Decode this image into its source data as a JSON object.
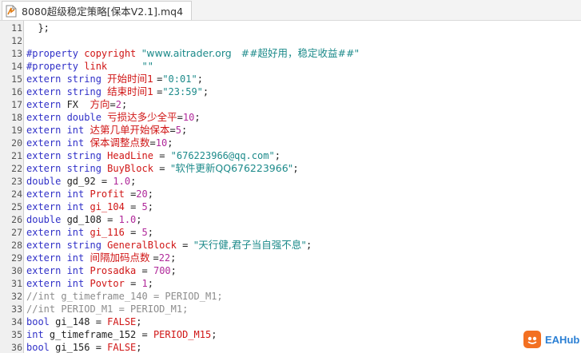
{
  "tab": {
    "title": "8080超级稳定策略[保本V2.1].mq4",
    "icon": "mq4-file-icon"
  },
  "watermark": {
    "text": "EAHub"
  },
  "lines": [
    {
      "n": "11",
      "tokens": [
        {
          "t": "  };",
          "c": "plain"
        }
      ]
    },
    {
      "n": "12",
      "tokens": []
    },
    {
      "n": "13",
      "tokens": [
        {
          "t": "#property ",
          "c": "kw"
        },
        {
          "t": "copyright ",
          "c": "red"
        },
        {
          "t": "\"www.aitrader.org   ##超好用，稳定收益##\"",
          "c": "str"
        }
      ]
    },
    {
      "n": "14",
      "tokens": [
        {
          "t": "#property ",
          "c": "kw"
        },
        {
          "t": "link      ",
          "c": "red"
        },
        {
          "t": "\"\"",
          "c": "str"
        }
      ]
    },
    {
      "n": "15",
      "tokens": [
        {
          "t": "extern ",
          "c": "kw"
        },
        {
          "t": "string ",
          "c": "kw"
        },
        {
          "t": "开始时间1 ",
          "c": "red"
        },
        {
          "t": "=",
          "c": "plain"
        },
        {
          "t": "\"0:01\"",
          "c": "str"
        },
        {
          "t": ";",
          "c": "plain"
        }
      ]
    },
    {
      "n": "16",
      "tokens": [
        {
          "t": "extern ",
          "c": "kw"
        },
        {
          "t": "string ",
          "c": "kw"
        },
        {
          "t": "结束时间1 ",
          "c": "red"
        },
        {
          "t": "=",
          "c": "plain"
        },
        {
          "t": "\"23:59\"",
          "c": "str"
        },
        {
          "t": ";",
          "c": "plain"
        }
      ]
    },
    {
      "n": "17",
      "tokens": [
        {
          "t": "extern ",
          "c": "kw"
        },
        {
          "t": "FX  ",
          "c": "plain"
        },
        {
          "t": "方向",
          "c": "red"
        },
        {
          "t": "=",
          "c": "plain"
        },
        {
          "t": "2",
          "c": "num"
        },
        {
          "t": ";",
          "c": "plain"
        }
      ]
    },
    {
      "n": "18",
      "tokens": [
        {
          "t": "extern ",
          "c": "kw"
        },
        {
          "t": "double ",
          "c": "kw"
        },
        {
          "t": "亏损达多少全平",
          "c": "red"
        },
        {
          "t": "=",
          "c": "plain"
        },
        {
          "t": "10",
          "c": "num"
        },
        {
          "t": ";",
          "c": "plain"
        }
      ]
    },
    {
      "n": "19",
      "tokens": [
        {
          "t": "extern ",
          "c": "kw"
        },
        {
          "t": "int ",
          "c": "kw"
        },
        {
          "t": "达第几单开始保本",
          "c": "red"
        },
        {
          "t": "=",
          "c": "plain"
        },
        {
          "t": "5",
          "c": "num"
        },
        {
          "t": ";",
          "c": "plain"
        }
      ]
    },
    {
      "n": "20",
      "tokens": [
        {
          "t": "extern ",
          "c": "kw"
        },
        {
          "t": "int ",
          "c": "kw"
        },
        {
          "t": "保本调整点数",
          "c": "red"
        },
        {
          "t": "=",
          "c": "plain"
        },
        {
          "t": "10",
          "c": "num"
        },
        {
          "t": ";",
          "c": "plain"
        }
      ]
    },
    {
      "n": "21",
      "tokens": [
        {
          "t": "extern ",
          "c": "kw"
        },
        {
          "t": "string ",
          "c": "kw"
        },
        {
          "t": "HeadLine ",
          "c": "red"
        },
        {
          "t": "= ",
          "c": "plain"
        },
        {
          "t": "\"676223966@qq.com\"",
          "c": "str"
        },
        {
          "t": ";",
          "c": "plain"
        }
      ]
    },
    {
      "n": "22",
      "tokens": [
        {
          "t": "extern ",
          "c": "kw"
        },
        {
          "t": "string ",
          "c": "kw"
        },
        {
          "t": "BuyBlock ",
          "c": "red"
        },
        {
          "t": "= ",
          "c": "plain"
        },
        {
          "t": "\"软件更新QQ676223966\"",
          "c": "str"
        },
        {
          "t": ";",
          "c": "plain"
        }
      ]
    },
    {
      "n": "23",
      "tokens": [
        {
          "t": "double ",
          "c": "kw"
        },
        {
          "t": "gd_92 = ",
          "c": "plain"
        },
        {
          "t": "1.0",
          "c": "num"
        },
        {
          "t": ";",
          "c": "plain"
        }
      ]
    },
    {
      "n": "24",
      "tokens": [
        {
          "t": "extern ",
          "c": "kw"
        },
        {
          "t": "int ",
          "c": "kw"
        },
        {
          "t": "Profit ",
          "c": "red"
        },
        {
          "t": "=",
          "c": "plain"
        },
        {
          "t": "20",
          "c": "num"
        },
        {
          "t": ";",
          "c": "plain"
        }
      ]
    },
    {
      "n": "25",
      "tokens": [
        {
          "t": "extern ",
          "c": "kw"
        },
        {
          "t": "int ",
          "c": "kw"
        },
        {
          "t": "gi_104 ",
          "c": "red"
        },
        {
          "t": "= ",
          "c": "plain"
        },
        {
          "t": "5",
          "c": "num"
        },
        {
          "t": ";",
          "c": "plain"
        }
      ]
    },
    {
      "n": "26",
      "tokens": [
        {
          "t": "double ",
          "c": "kw"
        },
        {
          "t": "gd_108 = ",
          "c": "plain"
        },
        {
          "t": "1.0",
          "c": "num"
        },
        {
          "t": ";",
          "c": "plain"
        }
      ]
    },
    {
      "n": "27",
      "tokens": [
        {
          "t": "extern ",
          "c": "kw"
        },
        {
          "t": "int ",
          "c": "kw"
        },
        {
          "t": "gi_116 ",
          "c": "red"
        },
        {
          "t": "= ",
          "c": "plain"
        },
        {
          "t": "5",
          "c": "num"
        },
        {
          "t": ";",
          "c": "plain"
        }
      ]
    },
    {
      "n": "28",
      "tokens": [
        {
          "t": "extern ",
          "c": "kw"
        },
        {
          "t": "string ",
          "c": "kw"
        },
        {
          "t": "GeneralBlock ",
          "c": "red"
        },
        {
          "t": "= ",
          "c": "plain"
        },
        {
          "t": "\"天行健,君子当自强不息\"",
          "c": "str"
        },
        {
          "t": ";",
          "c": "plain"
        }
      ]
    },
    {
      "n": "29",
      "tokens": [
        {
          "t": "extern ",
          "c": "kw"
        },
        {
          "t": "int ",
          "c": "kw"
        },
        {
          "t": "间隔加码点数 ",
          "c": "red"
        },
        {
          "t": "=",
          "c": "plain"
        },
        {
          "t": "22",
          "c": "num"
        },
        {
          "t": ";",
          "c": "plain"
        }
      ]
    },
    {
      "n": "30",
      "tokens": [
        {
          "t": "extern ",
          "c": "kw"
        },
        {
          "t": "int ",
          "c": "kw"
        },
        {
          "t": "Prosadka ",
          "c": "red"
        },
        {
          "t": "= ",
          "c": "plain"
        },
        {
          "t": "700",
          "c": "num"
        },
        {
          "t": ";",
          "c": "plain"
        }
      ]
    },
    {
      "n": "31",
      "tokens": [
        {
          "t": "extern ",
          "c": "kw"
        },
        {
          "t": "int ",
          "c": "kw"
        },
        {
          "t": "Povtor ",
          "c": "red"
        },
        {
          "t": "= ",
          "c": "plain"
        },
        {
          "t": "1",
          "c": "num"
        },
        {
          "t": ";",
          "c": "plain"
        }
      ]
    },
    {
      "n": "32",
      "tokens": [
        {
          "t": "//int g_timeframe_140 = PERIOD_M1;",
          "c": "cmt"
        }
      ]
    },
    {
      "n": "33",
      "tokens": [
        {
          "t": "//int PERIOD_M1 = PERIOD_M1;",
          "c": "cmt"
        }
      ]
    },
    {
      "n": "34",
      "tokens": [
        {
          "t": "bool ",
          "c": "kw"
        },
        {
          "t": "gi_148 = ",
          "c": "plain"
        },
        {
          "t": "FALSE",
          "c": "red"
        },
        {
          "t": ";",
          "c": "plain"
        }
      ]
    },
    {
      "n": "35",
      "tokens": [
        {
          "t": "int ",
          "c": "kw"
        },
        {
          "t": "g_timeframe_152 = ",
          "c": "plain"
        },
        {
          "t": "PERIOD_M15",
          "c": "red"
        },
        {
          "t": ";",
          "c": "plain"
        }
      ]
    },
    {
      "n": "36",
      "tokens": [
        {
          "t": "bool ",
          "c": "kw"
        },
        {
          "t": "gi_156 = ",
          "c": "plain"
        },
        {
          "t": "FALSE",
          "c": "red"
        },
        {
          "t": ";",
          "c": "plain"
        }
      ]
    }
  ]
}
